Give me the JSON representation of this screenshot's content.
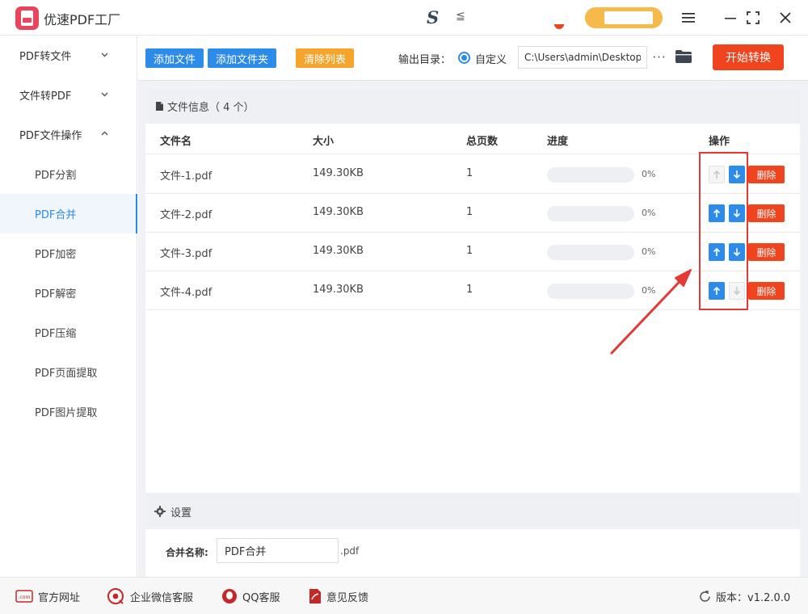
{
  "app": {
    "title": "优速PDF工厂",
    "brand_mark": "S",
    "brand_tail": "≦"
  },
  "sidebar": {
    "groups": [
      {
        "label": "PDF转文件",
        "expanded": false
      },
      {
        "label": "文件转PDF",
        "expanded": false
      },
      {
        "label": "PDF文件操作",
        "expanded": true
      }
    ],
    "items": [
      {
        "label": "PDF分割"
      },
      {
        "label": "PDF合并",
        "active": true
      },
      {
        "label": "PDF加密"
      },
      {
        "label": "PDF解密"
      },
      {
        "label": "PDF压缩"
      },
      {
        "label": "PDF页面提取"
      },
      {
        "label": "PDF图片提取"
      }
    ]
  },
  "toolbar": {
    "add_file": "添加文件",
    "add_folder": "添加文件夹",
    "clear_list": "清除列表",
    "output_label": "输出目录：",
    "custom_option": "自定义",
    "output_path": "C:\\Users\\admin\\Desktop",
    "more": "···",
    "start": "开始转换"
  },
  "file_panel": {
    "header": "文件信息（ 4 个）",
    "columns": {
      "name": "文件名",
      "size": "大小",
      "pages": "总页数",
      "progress": "进度",
      "actions": "操作"
    },
    "rows": [
      {
        "name": "文件-1.pdf",
        "size": "149.30KB",
        "pages": "1",
        "progress": 0,
        "progress_text": "0%",
        "up_enabled": false,
        "down_enabled": true,
        "delete": "删除"
      },
      {
        "name": "文件-2.pdf",
        "size": "149.30KB",
        "pages": "1",
        "progress": 0,
        "progress_text": "0%",
        "up_enabled": true,
        "down_enabled": true,
        "delete": "删除"
      },
      {
        "name": "文件-3.pdf",
        "size": "149.30KB",
        "pages": "1",
        "progress": 0,
        "progress_text": "0%",
        "up_enabled": true,
        "down_enabled": true,
        "delete": "删除"
      },
      {
        "name": "文件-4.pdf",
        "size": "149.30KB",
        "pages": "1",
        "progress": 0,
        "progress_text": "0%",
        "up_enabled": true,
        "down_enabled": false,
        "delete": "删除"
      }
    ]
  },
  "settings": {
    "header": "设置",
    "merge_name_label": "合并名称:",
    "merge_name_value": "PDF合并",
    "merge_ext": ".pdf"
  },
  "footer": {
    "website": "官方网址",
    "wechat": "企业微信客服",
    "qq": "QQ客服",
    "feedback": "意见反馈",
    "version": "版本：v1.2.0.0"
  },
  "colors": {
    "primary": "#2d8be9",
    "danger": "#f0441f",
    "warning": "#f6a52c",
    "annotation": "#e53935"
  },
  "icons": {
    "logo": "pdf-logo-icon",
    "menu": "hamburger-menu-icon",
    "minimize": "minimize-icon",
    "maximize": "maximize-icon",
    "close": "close-icon",
    "folder": "folder-icon",
    "file": "file-doc-icon",
    "settings": "gear-icon",
    "up": "arrow-up-icon",
    "down": "arrow-down-icon",
    "refresh": "refresh-icon"
  }
}
